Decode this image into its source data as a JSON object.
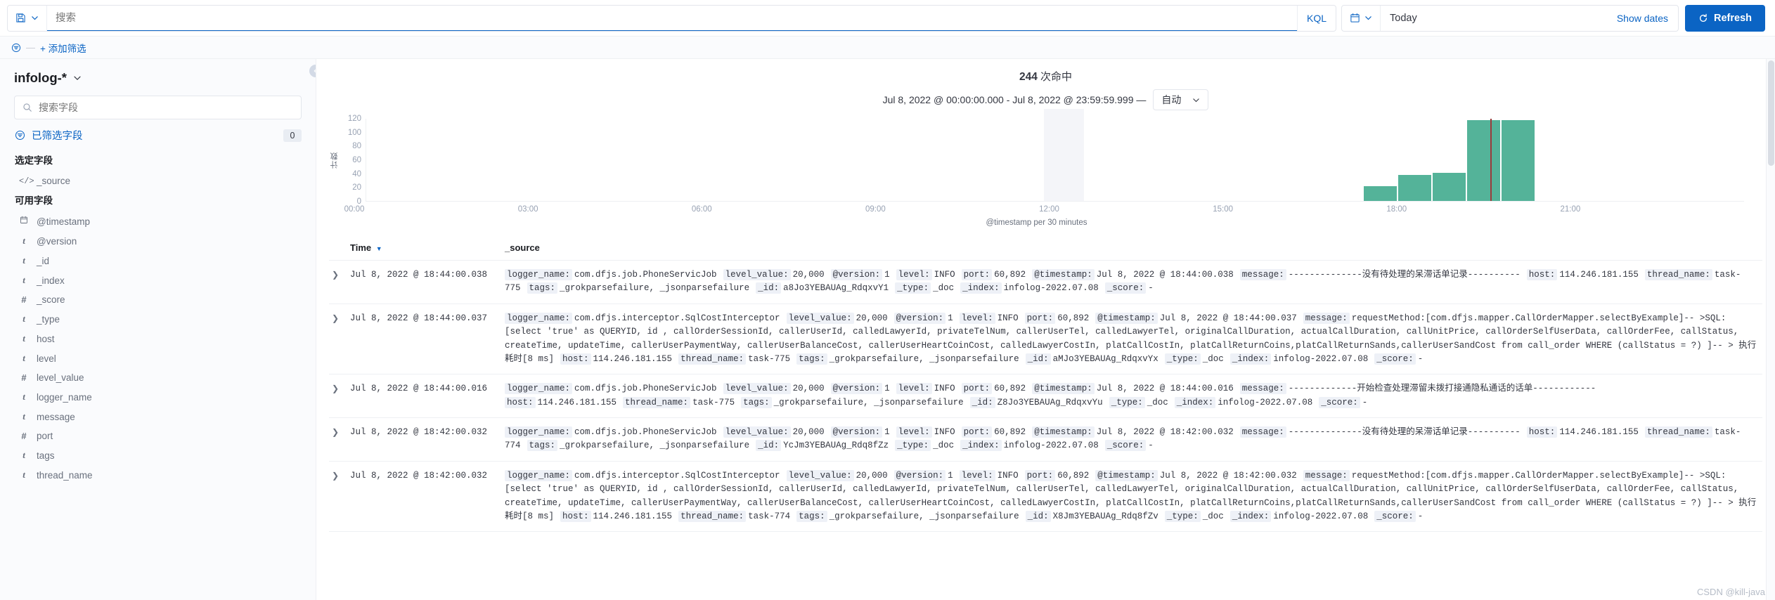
{
  "query_bar": {
    "saved_query_icon": "save-icon",
    "saved_query_caret": "chevron-down-icon",
    "search_placeholder": "搜索",
    "search_value": "",
    "language_badge": "KQL",
    "calendar_icon": "calendar-icon",
    "date_value": "Today",
    "show_dates_label": "Show dates",
    "refresh_label": "Refresh",
    "refresh_icon": "refresh-icon",
    "accent_color": "#0b64c4"
  },
  "filter_bar": {
    "filter_icon": "filter-icon",
    "dash": "—",
    "add_filter_label": "+ 添加筛选"
  },
  "sidebar": {
    "index_pattern": "infolog-*",
    "index_pattern_caret": "chevron-down-icon",
    "field_search_placeholder": "搜索字段",
    "field_search_value": "",
    "search_icon": "search-icon",
    "filtered_fields_icon": "filter-icon",
    "filtered_fields_label": "已筛选字段",
    "filtered_fields_count": "0",
    "selected_fields_title": "选定字段",
    "selected_fields": [
      {
        "name": "_source",
        "type": "source"
      }
    ],
    "available_fields_title": "可用字段",
    "available_fields": [
      {
        "name": "@timestamp",
        "type": "date"
      },
      {
        "name": "@version",
        "type": "string"
      },
      {
        "name": "_id",
        "type": "string"
      },
      {
        "name": "_index",
        "type": "string"
      },
      {
        "name": "_score",
        "type": "number"
      },
      {
        "name": "_type",
        "type": "string"
      },
      {
        "name": "host",
        "type": "string"
      },
      {
        "name": "level",
        "type": "string"
      },
      {
        "name": "level_value",
        "type": "number"
      },
      {
        "name": "logger_name",
        "type": "string"
      },
      {
        "name": "message",
        "type": "string"
      },
      {
        "name": "port",
        "type": "number"
      },
      {
        "name": "tags",
        "type": "string"
      },
      {
        "name": "thread_name",
        "type": "string"
      }
    ],
    "collapse_icon": "chevron-left-icon"
  },
  "chart_header": {
    "hits_count": "244",
    "hits_suffix": "次命中",
    "time_range": "Jul 8, 2022 @ 00:00:00.000 - Jul 8, 2022 @ 23:59:59.999 —",
    "interval_value": "自动",
    "interval_caret": "chevron-down-icon"
  },
  "chart_data": {
    "type": "bar",
    "title": "244 次命中",
    "xlabel": "@timestamp per 30 minutes",
    "ylabel": "计数",
    "bar_color": "#54b399",
    "grid": false,
    "legend": "none",
    "ylim": [
      0,
      120
    ],
    "yticks": [
      0,
      20,
      40,
      60,
      80,
      100,
      120
    ],
    "xticks": [
      "00:00",
      "03:00",
      "06:00",
      "09:00",
      "12:00",
      "15:00",
      "18:00",
      "21:00"
    ],
    "xlim_hours": [
      0,
      24
    ],
    "bucket_minutes": 30,
    "categories": [
      "17:30",
      "18:00",
      "18:30",
      "19:00",
      "19:30"
    ],
    "values": [
      22,
      38,
      41,
      118,
      118
    ],
    "bars": [
      {
        "x_hour": 17.5,
        "value": 22
      },
      {
        "x_hour": 18.0,
        "value": 38
      },
      {
        "x_hour": 18.5,
        "value": 41
      },
      {
        "x_hour": 19.0,
        "value": 118
      },
      {
        "x_hour": 19.5,
        "value": 118
      }
    ],
    "annotations": [
      {
        "kind": "hover-band",
        "x_hour_start": 11.8,
        "x_hour_end": 12.5
      },
      {
        "kind": "current-time-marker",
        "x_hour": 19.3,
        "color": "#9b3b3b"
      }
    ]
  },
  "doc_table": {
    "columns": [
      "Time",
      "_source"
    ],
    "sort_column": "Time",
    "sort_dir": "desc",
    "expand_icon": "chevron-right-icon",
    "rows": [
      {
        "time": "Jul 8, 2022 @ 18:44:00.038",
        "fields": [
          {
            "k": "logger_name:",
            "v": "com.dfjs.job.PhoneServicJob"
          },
          {
            "k": "level_value:",
            "v": "20,000"
          },
          {
            "k": "@version:",
            "v": "1"
          },
          {
            "k": "level:",
            "v": "INFO"
          },
          {
            "k": "port:",
            "v": "60,892"
          },
          {
            "k": "@timestamp:",
            "v": "Jul 8, 2022 @ 18:44:00.038"
          },
          {
            "k": "message:",
            "v": "--------------没有待处理的呆滞话单记录----------"
          },
          {
            "k": "host:",
            "v": "114.246.181.155"
          },
          {
            "k": "thread_name:",
            "v": "task-775"
          },
          {
            "k": "tags:",
            "v": "_grokparsefailure, _jsonparsefailure"
          },
          {
            "k": "_id:",
            "v": "a8Jo3YEBAUAg_RdqxvY1"
          },
          {
            "k": "_type:",
            "v": "_doc"
          },
          {
            "k": "_index:",
            "v": "infolog-2022.07.08"
          },
          {
            "k": "_score:",
            "v": "-"
          }
        ]
      },
      {
        "time": "Jul 8, 2022 @ 18:44:00.037",
        "fields": [
          {
            "k": "logger_name:",
            "v": "com.dfjs.interceptor.SqlCostInterceptor"
          },
          {
            "k": "level_value:",
            "v": "20,000"
          },
          {
            "k": "@version:",
            "v": "1"
          },
          {
            "k": "level:",
            "v": "INFO"
          },
          {
            "k": "port:",
            "v": "60,892"
          },
          {
            "k": "@timestamp:",
            "v": "Jul 8, 2022 @ 18:44:00.037"
          },
          {
            "k": "message:",
            "v": "requestMethod:[com.dfjs.mapper.CallOrderMapper.selectByExample]-- >SQL:[select 'true' as QUERYID, id , callOrderSessionId, callerUserId, calledLawyerId, privateTelNum, callerUserTel, calledLawyerTel, originalCallDuration, actualCallDuration, callUnitPrice, callOrderSelfUserData, callOrderFee, callStatus, createTime, updateTime, callerUserPaymentWay, callerUserBalanceCost, callerUserHeartCoinCost, calledLawyerCostIn, platCallCostIn, platCallReturnCoins,platCallReturnSands,callerUserSandCost from call_order WHERE (callStatus = ?) ]-- > 执行耗时[8 ms]"
          },
          {
            "k": "host:",
            "v": "114.246.181.155"
          },
          {
            "k": "thread_name:",
            "v": "task-775"
          },
          {
            "k": "tags:",
            "v": "_grokparsefailure, _jsonparsefailure"
          },
          {
            "k": "_id:",
            "v": "aMJo3YEBAUAg_RdqxvYx"
          },
          {
            "k": "_type:",
            "v": "_doc"
          },
          {
            "k": "_index:",
            "v": "infolog-2022.07.08"
          },
          {
            "k": "_score:",
            "v": "-"
          }
        ]
      },
      {
        "time": "Jul 8, 2022 @ 18:44:00.016",
        "fields": [
          {
            "k": "logger_name:",
            "v": "com.dfjs.job.PhoneServicJob"
          },
          {
            "k": "level_value:",
            "v": "20,000"
          },
          {
            "k": "@version:",
            "v": "1"
          },
          {
            "k": "level:",
            "v": "INFO"
          },
          {
            "k": "port:",
            "v": "60,892"
          },
          {
            "k": "@timestamp:",
            "v": "Jul 8, 2022 @ 18:44:00.016"
          },
          {
            "k": "message:",
            "v": "-------------开始检查处理滞留未拨打接通隐私通话的话单------------"
          },
          {
            "k": "host:",
            "v": "114.246.181.155"
          },
          {
            "k": "thread_name:",
            "v": "task-775"
          },
          {
            "k": "tags:",
            "v": "_grokparsefailure, _jsonparsefailure"
          },
          {
            "k": "_id:",
            "v": "Z8Jo3YEBAUAg_RdqxvYu"
          },
          {
            "k": "_type:",
            "v": "_doc"
          },
          {
            "k": "_index:",
            "v": "infolog-2022.07.08"
          },
          {
            "k": "_score:",
            "v": "-"
          }
        ]
      },
      {
        "time": "Jul 8, 2022 @ 18:42:00.032",
        "fields": [
          {
            "k": "logger_name:",
            "v": "com.dfjs.job.PhoneServicJob"
          },
          {
            "k": "level_value:",
            "v": "20,000"
          },
          {
            "k": "@version:",
            "v": "1"
          },
          {
            "k": "level:",
            "v": "INFO"
          },
          {
            "k": "port:",
            "v": "60,892"
          },
          {
            "k": "@timestamp:",
            "v": "Jul 8, 2022 @ 18:42:00.032"
          },
          {
            "k": "message:",
            "v": "--------------没有待处理的呆滞话单记录----------"
          },
          {
            "k": "host:",
            "v": "114.246.181.155"
          },
          {
            "k": "thread_name:",
            "v": "task-774"
          },
          {
            "k": "tags:",
            "v": "_grokparsefailure, _jsonparsefailure"
          },
          {
            "k": "_id:",
            "v": "YcJm3YEBAUAg_Rdq8fZz"
          },
          {
            "k": "_type:",
            "v": "_doc"
          },
          {
            "k": "_index:",
            "v": "infolog-2022.07.08"
          },
          {
            "k": "_score:",
            "v": "-"
          }
        ]
      },
      {
        "time": "Jul 8, 2022 @ 18:42:00.032",
        "fields": [
          {
            "k": "logger_name:",
            "v": "com.dfjs.interceptor.SqlCostInterceptor"
          },
          {
            "k": "level_value:",
            "v": "20,000"
          },
          {
            "k": "@version:",
            "v": "1"
          },
          {
            "k": "level:",
            "v": "INFO"
          },
          {
            "k": "port:",
            "v": "60,892"
          },
          {
            "k": "@timestamp:",
            "v": "Jul 8, 2022 @ 18:42:00.032"
          },
          {
            "k": "message:",
            "v": "requestMethod:[com.dfjs.mapper.CallOrderMapper.selectByExample]-- >SQL:[select 'true' as QUERYID, id , callOrderSessionId, callerUserId, calledLawyerId, privateTelNum, callerUserTel, calledLawyerTel, originalCallDuration, actualCallDuration, callUnitPrice, callOrderSelfUserData, callOrderFee, callStatus, createTime, updateTime, callerUserPaymentWay, callerUserBalanceCost, callerUserHeartCoinCost, calledLawyerCostIn, platCallCostIn, platCallReturnCoins,platCallReturnSands,callerUserSandCost from call_order WHERE (callStatus = ?) ]-- > 执行耗时[8 ms]"
          },
          {
            "k": "host:",
            "v": "114.246.181.155"
          },
          {
            "k": "thread_name:",
            "v": "task-774"
          },
          {
            "k": "tags:",
            "v": "_grokparsefailure, _jsonparsefailure"
          },
          {
            "k": "_id:",
            "v": "X8Jm3YEBAUAg_Rdq8fZv"
          },
          {
            "k": "_type:",
            "v": "_doc"
          },
          {
            "k": "_index:",
            "v": "infolog-2022.07.08"
          },
          {
            "k": "_score:",
            "v": "-"
          }
        ]
      }
    ]
  },
  "watermark": "CSDN @kill-java"
}
